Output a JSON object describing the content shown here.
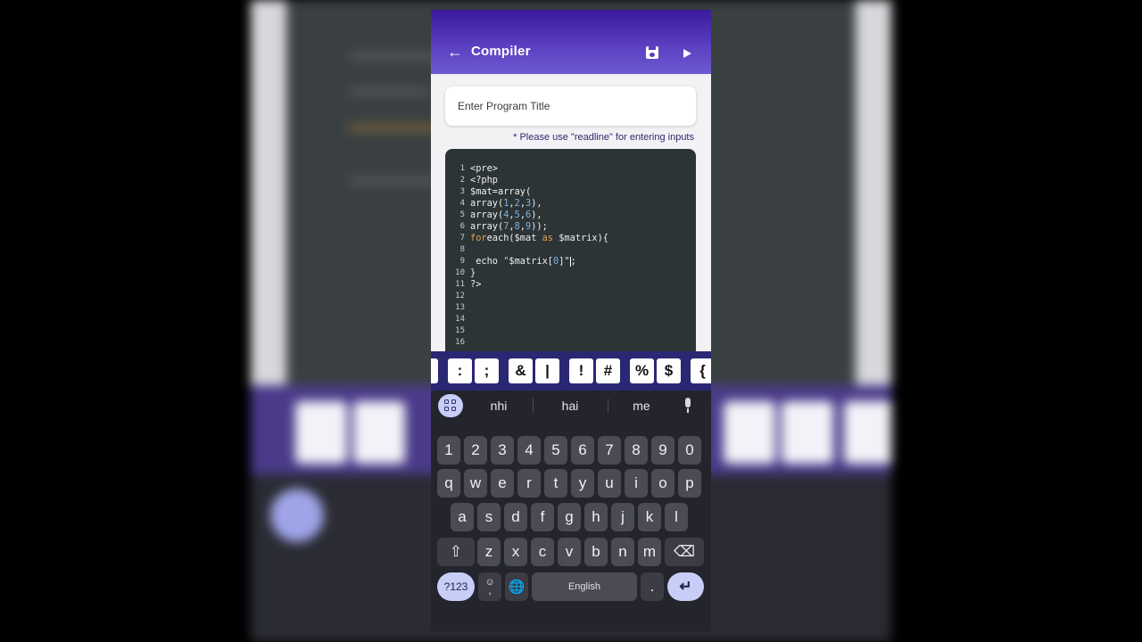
{
  "app": {
    "title": "Compiler",
    "back_icon": "arrow-left-icon",
    "save_icon": "save-icon",
    "run_icon": "play-icon"
  },
  "form": {
    "title_placeholder": "Enter Program Title",
    "hint": "* Please use \"readline\" for entering inputs"
  },
  "editor": {
    "line_numbers": [
      "1",
      "2",
      "3",
      "4",
      "5",
      "6",
      "7",
      "8",
      "9",
      "10",
      "11",
      "12",
      "13",
      "14",
      "15",
      "16"
    ],
    "lines": [
      "<pre>",
      "<?php",
      "$mat=array(",
      "array(1,2,3),",
      "array(4,5,6),",
      "array(7,8,9));",
      "foreach($mat as $matrix){",
      "",
      " echo \"$matrix[0]\";",
      "}",
      "?>",
      "",
      "",
      "",
      "",
      ""
    ]
  },
  "symbols": [
    ":",
    ";",
    "&",
    "|",
    "!",
    "#",
    "%",
    "$",
    "{"
  ],
  "keyboard": {
    "suggestions": [
      "nhi",
      "hai",
      "me"
    ],
    "numbers": [
      "1",
      "2",
      "3",
      "4",
      "5",
      "6",
      "7",
      "8",
      "9",
      "0"
    ],
    "row1": [
      "q",
      "w",
      "e",
      "r",
      "t",
      "y",
      "u",
      "i",
      "o",
      "p"
    ],
    "row2": [
      "a",
      "s",
      "d",
      "f",
      "g",
      "h",
      "j",
      "k",
      "l"
    ],
    "row3": [
      "z",
      "x",
      "c",
      "v",
      "b",
      "n",
      "m"
    ],
    "sym_key": "?123",
    "comma": ",",
    "space_label": "English",
    "period": ".",
    "emoji_glyph": "☺",
    "globe_glyph": "🌐",
    "enter_glyph": "↵",
    "shift_glyph": "⇧",
    "backspace_glyph": "⌫"
  },
  "colors": {
    "appbar": "#5b3fc1",
    "editor_bg": "#2d3436",
    "keyword": "#e1a55a",
    "number": "#7fb3e0",
    "keyboard_bg": "#23242c",
    "accent_key": "#c7cdf6"
  }
}
